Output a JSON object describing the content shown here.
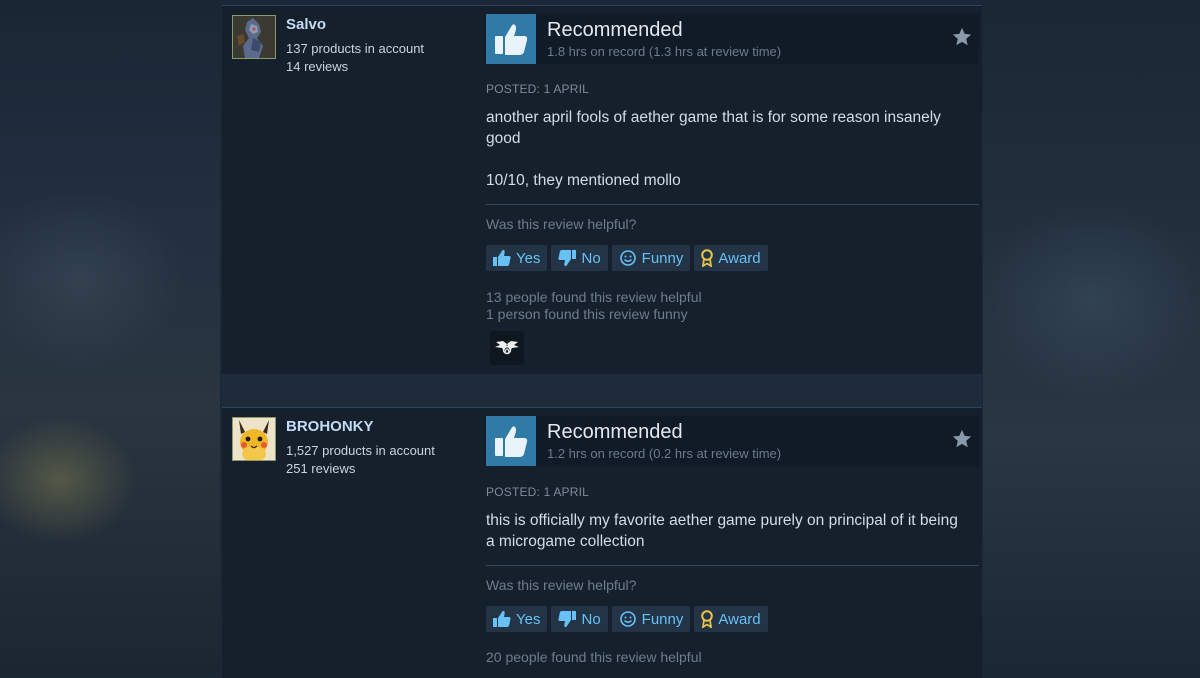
{
  "reviews": [
    {
      "username": "Salvo",
      "products": "137 products in account",
      "review_count": "14 reviews",
      "recommendation": "Recommended",
      "hours": "1.8 hrs on record (1.3 hrs at review time)",
      "posted": "POSTED: 1 APRIL",
      "paragraphs": [
        "another april fools of aether game that is for some reason insanely good",
        "10/10, they mentioned mollo"
      ],
      "helpful_question": "Was this review helpful?",
      "buttons": {
        "yes": "Yes",
        "no": "No",
        "funny": "Funny",
        "award": "Award"
      },
      "helpful_count": "13 people found this review helpful",
      "funny_count": "1 person found this review funny",
      "avatar_icon": "avatar-armored-character",
      "reaction_icon": "winged-award-icon"
    },
    {
      "username": "BROHONKY",
      "products": "1,527 products in account",
      "review_count": "251 reviews",
      "recommendation": "Recommended",
      "hours": "1.2 hrs on record (0.2 hrs at review time)",
      "posted": "POSTED: 1 APRIL",
      "paragraphs": [
        "this is officially my favorite aether game purely on principal of it being a microgame collection"
      ],
      "helpful_question": "Was this review helpful?",
      "buttons": {
        "yes": "Yes",
        "no": "No",
        "funny": "Funny",
        "award": "Award"
      },
      "helpful_count": "20 people found this review helpful",
      "avatar_icon": "avatar-yellow-creature"
    }
  ],
  "colors": {
    "background": "#1b2838",
    "review_bg": "#16202d",
    "thumb_box": "#2f7aa6",
    "link_blue": "#67c1f5",
    "username": "#c1dbf4",
    "award_gold": "#e8c24a"
  }
}
